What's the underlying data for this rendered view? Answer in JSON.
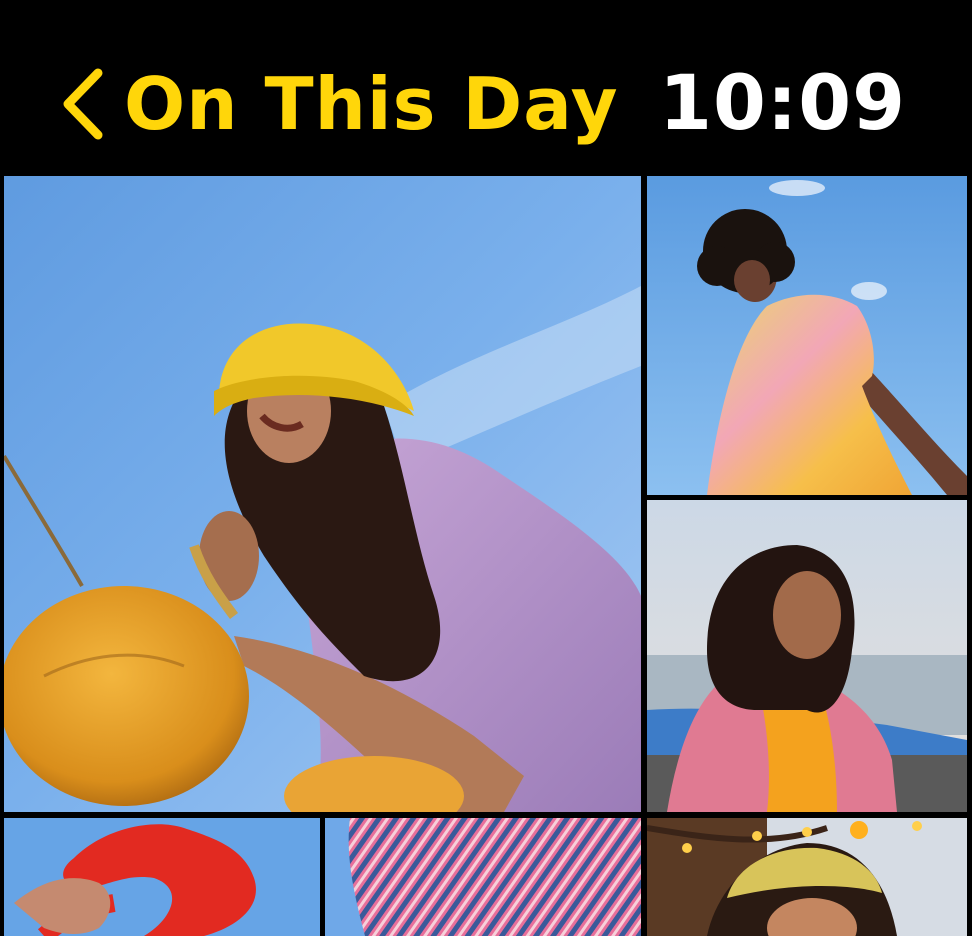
{
  "nav": {
    "back_icon": "chevron-left-icon",
    "title": "On This Day"
  },
  "status": {
    "time": "10:09"
  },
  "colors": {
    "accent": "#FFD60A",
    "background": "#000000",
    "time_text": "#FFFFFF"
  },
  "photos": [
    {
      "id": "photo-main",
      "subject": "woman in yellow bucket hat laughing holding coconut"
    },
    {
      "id": "photo-right-1",
      "subject": "man with curly hair in pastel shirt against sky"
    },
    {
      "id": "photo-right-2",
      "subject": "woman with windswept hair by the sea"
    },
    {
      "id": "photo-bottom-1",
      "subject": "hands with red ruffled fabric against sky"
    },
    {
      "id": "photo-bottom-2",
      "subject": "pink striped pleated fabric"
    },
    {
      "id": "photo-bottom-3",
      "subject": "woman with lace headband under string lights"
    }
  ]
}
